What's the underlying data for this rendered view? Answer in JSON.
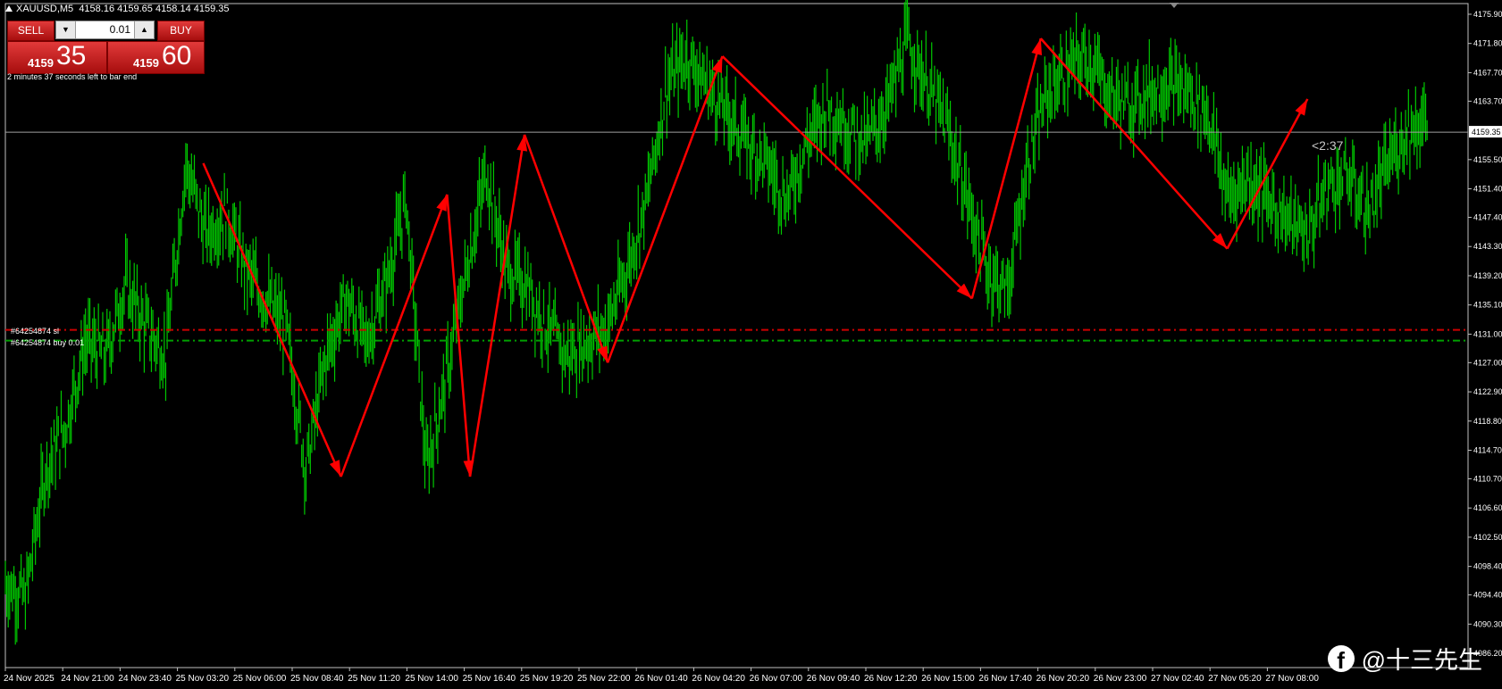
{
  "header": {
    "symbol": "XAUUSD,M5",
    "ohlc": "4158.16 4159.65 4158.14 4159.35"
  },
  "trade_panel": {
    "sell_label": "SELL",
    "buy_label": "BUY",
    "lot": "0.01",
    "dec_icon": "triangle-down-icon",
    "inc_icon": "triangle-up-icon",
    "sell_small": "4159",
    "sell_big": "35",
    "buy_small": "4159",
    "buy_big": "60"
  },
  "countdown_text": "2 minutes 37 seconds left to bar end",
  "orders": {
    "sl_label": "#64254874 sl",
    "buy_label": "#64254874 buy 0.01"
  },
  "timer_label": "<2:37",
  "watermark": {
    "icon": "facebook-icon",
    "text": "@十三先生"
  },
  "colors": {
    "background": "#000000",
    "candles": "#00c800",
    "arrows": "#ff0000",
    "sl_line": "#cc0000",
    "entry_line": "#00a000",
    "price_line": "#a0a0a0",
    "button": "#c81e1e"
  },
  "chart_data": {
    "type": "line",
    "price_axis_ticks": [
      "4175.90",
      "4171.80",
      "4167.70",
      "4163.70",
      "4159.35",
      "4155.50",
      "4151.40",
      "4147.40",
      "4143.30",
      "4139.20",
      "4135.10",
      "4131.00",
      "4127.00",
      "4122.90",
      "4118.80",
      "4114.70",
      "4110.70",
      "4106.60",
      "4102.50",
      "4098.40",
      "4094.40",
      "4090.30",
      "4086.20"
    ],
    "current_price": 4159.35,
    "sl_price": 4131.6,
    "entry_price": 4130.1,
    "time_axis_labels": [
      "24 Nov 2025",
      "24 Nov 21:00",
      "24 Nov 23:40",
      "25 Nov 03:20",
      "25 Nov 06:00",
      "25 Nov 08:40",
      "25 Nov 11:20",
      "25 Nov 14:00",
      "25 Nov 16:40",
      "25 Nov 19:20",
      "25 Nov 22:00",
      "26 Nov 01:40",
      "26 Nov 04:20",
      "26 Nov 07:00",
      "26 Nov 09:40",
      "26 Nov 12:20",
      "26 Nov 15:00",
      "26 Nov 17:40",
      "26 Nov 20:20",
      "26 Nov 23:00",
      "27 Nov 02:40",
      "27 Nov 05:20",
      "27 Nov 08:00"
    ],
    "price_path": [
      {
        "i": 0,
        "p": 4096
      },
      {
        "i": 1,
        "p": 4094
      },
      {
        "i": 2,
        "p": 4112
      },
      {
        "i": 3,
        "p": 4118
      },
      {
        "i": 4,
        "p": 4130
      },
      {
        "i": 5,
        "p": 4128
      },
      {
        "i": 6,
        "p": 4138
      },
      {
        "i": 7,
        "p": 4132
      },
      {
        "i": 8,
        "p": 4128
      },
      {
        "i": 9,
        "p": 4155
      },
      {
        "i": 10,
        "p": 4145
      },
      {
        "i": 11,
        "p": 4148
      },
      {
        "i": 12,
        "p": 4140
      },
      {
        "i": 13,
        "p": 4136
      },
      {
        "i": 14,
        "p": 4132
      },
      {
        "i": 15,
        "p": 4112
      },
      {
        "i": 16,
        "p": 4128
      },
      {
        "i": 17,
        "p": 4136
      },
      {
        "i": 18,
        "p": 4130
      },
      {
        "i": 19,
        "p": 4138
      },
      {
        "i": 20,
        "p": 4150
      },
      {
        "i": 21,
        "p": 4112
      },
      {
        "i": 22,
        "p": 4125
      },
      {
        "i": 23,
        "p": 4140
      },
      {
        "i": 24,
        "p": 4154
      },
      {
        "i": 25,
        "p": 4140
      },
      {
        "i": 26,
        "p": 4138
      },
      {
        "i": 27,
        "p": 4132
      },
      {
        "i": 28,
        "p": 4128
      },
      {
        "i": 29,
        "p": 4130
      },
      {
        "i": 30,
        "p": 4132
      },
      {
        "i": 31,
        "p": 4140
      },
      {
        "i": 32,
        "p": 4150
      },
      {
        "i": 33,
        "p": 4166
      },
      {
        "i": 34,
        "p": 4170
      },
      {
        "i": 35,
        "p": 4166
      },
      {
        "i": 36,
        "p": 4162
      },
      {
        "i": 37,
        "p": 4158
      },
      {
        "i": 38,
        "p": 4155
      },
      {
        "i": 39,
        "p": 4150
      },
      {
        "i": 40,
        "p": 4158
      },
      {
        "i": 41,
        "p": 4163
      },
      {
        "i": 42,
        "p": 4160
      },
      {
        "i": 43,
        "p": 4158
      },
      {
        "i": 44,
        "p": 4163
      },
      {
        "i": 45,
        "p": 4172
      },
      {
        "i": 46,
        "p": 4166
      },
      {
        "i": 47,
        "p": 4160
      },
      {
        "i": 48,
        "p": 4150
      },
      {
        "i": 49,
        "p": 4140
      },
      {
        "i": 50,
        "p": 4137
      },
      {
        "i": 51,
        "p": 4155
      },
      {
        "i": 52,
        "p": 4165
      },
      {
        "i": 53,
        "p": 4168
      },
      {
        "i": 54,
        "p": 4170
      },
      {
        "i": 55,
        "p": 4165
      },
      {
        "i": 56,
        "p": 4163
      },
      {
        "i": 57,
        "p": 4165
      },
      {
        "i": 58,
        "p": 4166
      },
      {
        "i": 59,
        "p": 4165
      },
      {
        "i": 60,
        "p": 4162
      },
      {
        "i": 61,
        "p": 4150
      },
      {
        "i": 62,
        "p": 4153
      },
      {
        "i": 63,
        "p": 4150
      },
      {
        "i": 64,
        "p": 4147
      },
      {
        "i": 65,
        "p": 4145
      },
      {
        "i": 66,
        "p": 4152
      },
      {
        "i": 67,
        "p": 4153
      },
      {
        "i": 68,
        "p": 4148
      },
      {
        "i": 69,
        "p": 4155
      },
      {
        "i": 70,
        "p": 4160
      },
      {
        "i": 71,
        "p": 4161
      }
    ],
    "zigzag": [
      {
        "t": 3.45,
        "p": 4155.0
      },
      {
        "t": 5.85,
        "p": 4111.0
      },
      {
        "t": 7.7,
        "p": 4150.6
      },
      {
        "t": 8.1,
        "p": 4111.0
      },
      {
        "t": 9.05,
        "p": 4159.0
      },
      {
        "t": 10.5,
        "p": 4127.0
      },
      {
        "t": 12.5,
        "p": 4170.0
      },
      {
        "t": 16.85,
        "p": 4136.0
      },
      {
        "t": 18.05,
        "p": 4172.5
      },
      {
        "t": 21.3,
        "p": 4143.0
      },
      {
        "t": 22.7,
        "p": 4164.0
      }
    ],
    "arrowheads": [
      1,
      2,
      3,
      4,
      5,
      6,
      7,
      8,
      9,
      10
    ],
    "ylim": [
      4084.2,
      4177.4
    ],
    "grid": false
  }
}
